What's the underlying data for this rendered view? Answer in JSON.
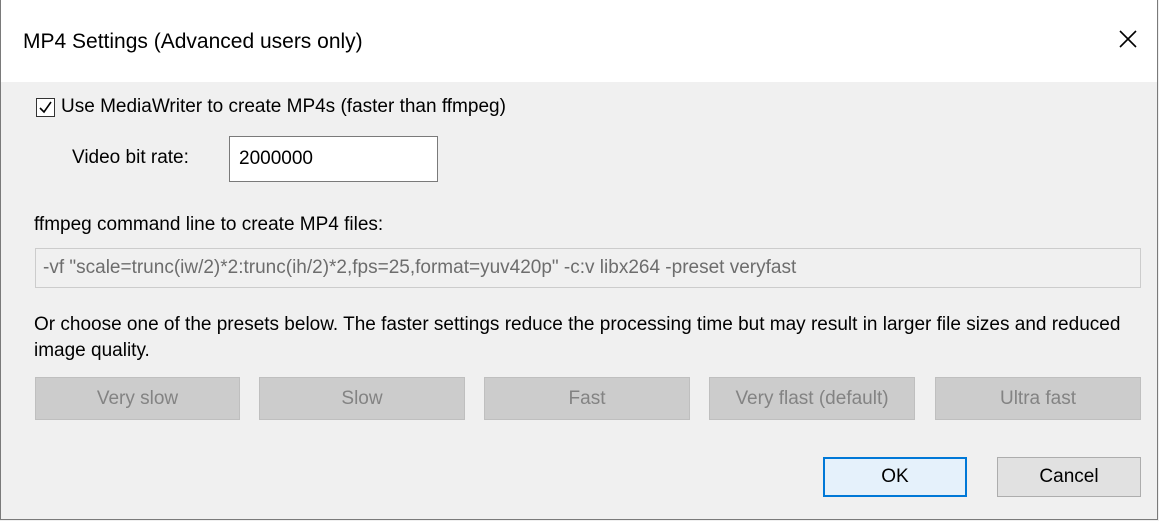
{
  "window": {
    "title": "MP4 Settings (Advanced users only)"
  },
  "mediawriter": {
    "checked": true,
    "label": "Use MediaWriter to create MP4s (faster than ffmpeg)"
  },
  "bitrate": {
    "label": "Video bit rate:",
    "value": "2000000"
  },
  "ffmpeg": {
    "label": "ffmpeg command line to create MP4 files:",
    "value": "-vf \"scale=trunc(iw/2)*2:trunc(ih/2)*2,fps=25,format=yuv420p\" -c:v libx264 -preset veryfast"
  },
  "description": "Or choose one of the presets below. The faster settings reduce the processing time but may result in larger file sizes and reduced image quality.",
  "presets": [
    {
      "label": "Very slow"
    },
    {
      "label": "Slow"
    },
    {
      "label": "Fast"
    },
    {
      "label": "Very flast (default)"
    },
    {
      "label": "Ultra fast"
    }
  ],
  "buttons": {
    "ok": "OK",
    "cancel": "Cancel"
  },
  "icons": {
    "close": "close-icon",
    "check": "checkmark-icon"
  },
  "colors": {
    "accent": "#0078d7",
    "disabled_button": "#cccccc",
    "disabled_text": "#838383"
  }
}
